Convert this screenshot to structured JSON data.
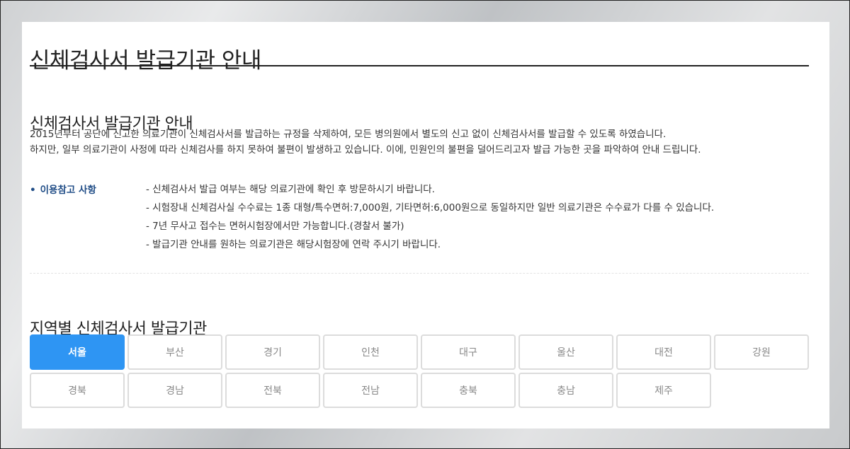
{
  "page": {
    "title": "신체검사서 발급기관 안내"
  },
  "intro_section": {
    "heading": "신체검사서 발급기관 안내",
    "lines": [
      "2015년부터 공단에 신고한 의료기관이 신체검사서를 발급하는 규정을 삭제하여, 모든 병의원에서 별도의 신고 없이 신체검사서를 발급할 수 있도록 하였습니다.",
      "하지만, 일부 의료기관이 사정에 따라 신체검사를 하지 못하여 불편이 발생하고 있습니다. 이에, 민원인의 불편을 덜어드리고자 발급 가능한 곳을 파악하여 안내 드립니다."
    ]
  },
  "notes": {
    "label": "이용참고 사항",
    "items": [
      "- 신체검사서 발급 여부는 해당 의료기관에 확인 후 방문하시기 바랍니다.",
      "- 시험장내 신체검사실 수수료는 1종 대형/특수면허:7,000원, 기타면허:6,000원으로 동일하지만 일반 의료기관은 수수료가 다를 수 있습니다.",
      "- 7년 무사고 접수는 면허시험장에서만 가능합니다.(경찰서 불가)",
      "- 발급기관 안내를 원하는 의료기관은 해당시험장에 연락 주시기 바랍니다."
    ]
  },
  "regions_section": {
    "heading": "지역별 신체검사서 발급기관",
    "selected": "서울",
    "regions": [
      "서울",
      "부산",
      "경기",
      "인천",
      "대구",
      "울산",
      "대전",
      "강원",
      "경북",
      "경남",
      "전북",
      "전남",
      "충북",
      "충남",
      "제주"
    ]
  },
  "colors": {
    "accent": "#2e95f3",
    "notes_label": "#1f4c86",
    "button_border": "#dcdcdc"
  }
}
